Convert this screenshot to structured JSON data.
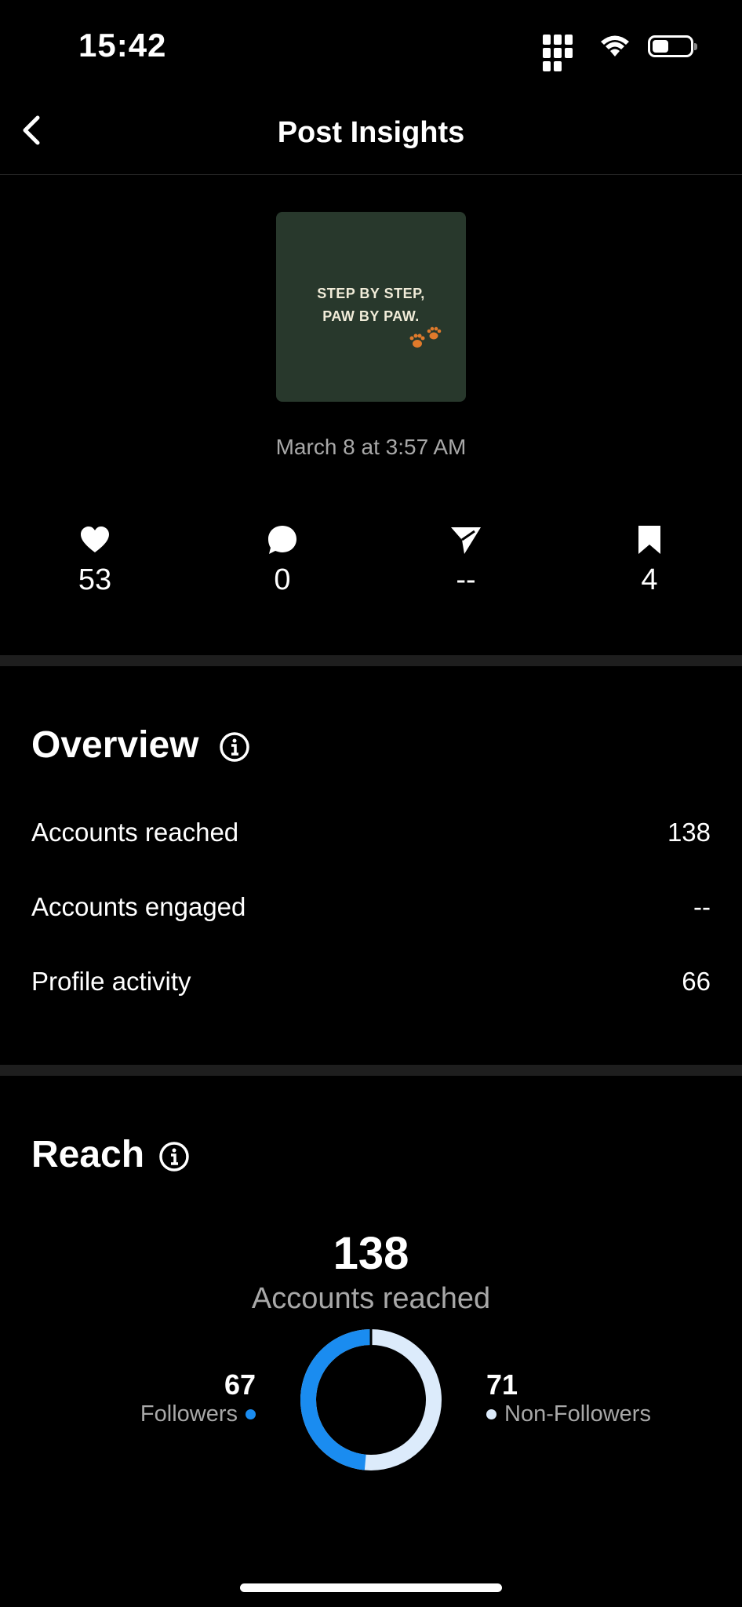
{
  "status": {
    "time": "15:42"
  },
  "header": {
    "title": "Post Insights"
  },
  "post": {
    "thumb_line1": "STEP BY STEP,",
    "thumb_line2": "PAW BY PAW.",
    "date": "March 8 at 3:57 AM"
  },
  "metrics": {
    "likes": "53",
    "comments": "0",
    "shares": "--",
    "saves": "4"
  },
  "overview": {
    "title": "Overview",
    "rows": [
      {
        "label": "Accounts reached",
        "value": "138"
      },
      {
        "label": "Accounts engaged",
        "value": "--"
      },
      {
        "label": "Profile activity",
        "value": "66"
      }
    ]
  },
  "reach": {
    "title": "Reach",
    "total": "138",
    "total_label": "Accounts reached",
    "followers": {
      "value": "67",
      "label": "Followers"
    },
    "non_followers": {
      "value": "71",
      "label": "Non-Followers"
    }
  },
  "colors": {
    "followers": "#1a8cf0",
    "non_followers": "#dcebfb",
    "thumb_bg": "#28382c",
    "paw": "#e07a2b"
  }
}
